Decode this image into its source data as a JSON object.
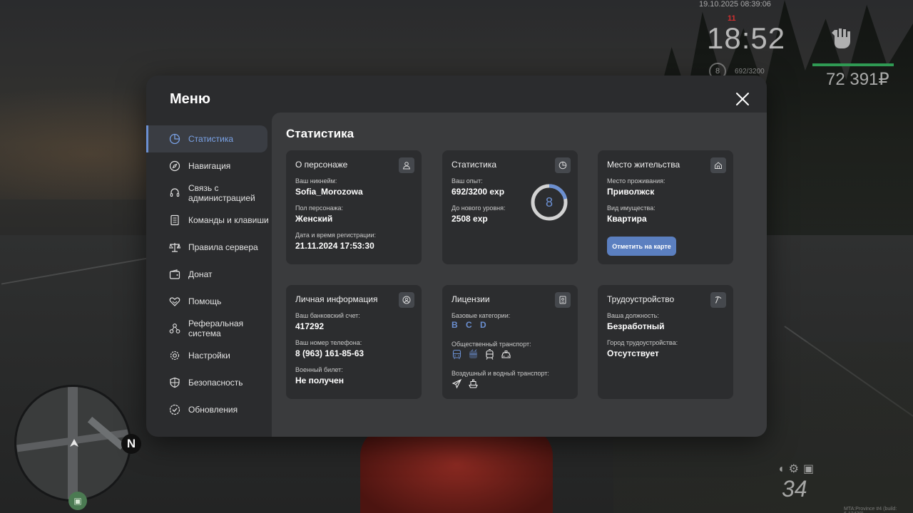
{
  "hud": {
    "datetime": "19.10.2025 08:39:06",
    "ping": "11",
    "clock": "18:52",
    "level": "8",
    "exp": "692/3200",
    "money": "72 391₽",
    "north": "N",
    "speed": "34",
    "build": "MTA:Province #4 (build: 6.12420)"
  },
  "menu": {
    "title": "Меню",
    "close_icon": "close-icon",
    "nav": [
      {
        "label": "Статистика",
        "icon": "pie-chart-icon",
        "active": true
      },
      {
        "label": "Навигация",
        "icon": "compass-icon"
      },
      {
        "label": "Связь с администрацией",
        "icon": "headset-icon"
      },
      {
        "label": "Команды и клавиши",
        "icon": "document-icon"
      },
      {
        "label": "Правила сервера",
        "icon": "scales-icon"
      },
      {
        "label": "Донат",
        "icon": "wallet-icon"
      },
      {
        "label": "Помощь",
        "icon": "handshake-icon"
      },
      {
        "label": "Реферальная система",
        "icon": "network-icon"
      },
      {
        "label": "Настройки",
        "icon": "gear-icon"
      },
      {
        "label": "Безопасность",
        "icon": "shield-icon"
      },
      {
        "label": "Обновления",
        "icon": "check-badge-icon"
      }
    ]
  },
  "content": {
    "title": "Статистика",
    "character": {
      "title": "О персонаже",
      "nickname_label": "Ваш никнейм:",
      "nickname": "Sofia_Morozowa",
      "gender_label": "Пол персонажа:",
      "gender": "Женский",
      "reg_label": "Дата и время регистрации:",
      "reg": "21.11.2024 17:53:30"
    },
    "stats": {
      "title": "Статистика",
      "exp_label": "Ваш опыт:",
      "exp": "692/3200 exp",
      "next_label": "До нового уровня:",
      "next": "2508 exp",
      "level": "8",
      "level_progress": 0.216
    },
    "residence": {
      "title": "Место жительства",
      "place_label": "Место проживания:",
      "place": "Приволжск",
      "property_label": "Вид имущества:",
      "property": "Квартира",
      "map_button": "Отметить на карте"
    },
    "personal": {
      "title": "Личная информация",
      "bank_label": "Ваш банковский счет:",
      "bank": "417292",
      "phone_label": "Ваш номер телефона:",
      "phone": "8 (963) 161-85-63",
      "military_label": "Военный билет:",
      "military": "Не получен"
    },
    "licenses": {
      "title": "Лицензии",
      "base_label": "Базовые категории:",
      "categories": [
        "B",
        "C",
        "D"
      ],
      "public_label": "Общественный транспорт:",
      "air_label": "Воздушный и водный транспорт:"
    },
    "employment": {
      "title": "Трудоустройство",
      "position_label": "Ваша должность:",
      "position": "Безработный",
      "city_label": "Город трудоустройства:",
      "city": "Отсутствует"
    }
  },
  "colors": {
    "accent": "#6b8fd1",
    "button": "#5b7fc0",
    "panel": "#2b2c2e",
    "content": "#3a3b3d",
    "card": "#2c2d2f"
  }
}
